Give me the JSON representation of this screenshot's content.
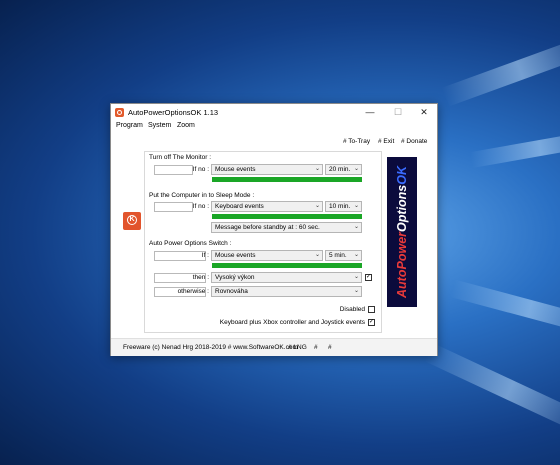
{
  "window": {
    "title": "AutoPowerOptionsOK 1.13",
    "controls": {
      "minimize": "—",
      "maximize": "☐",
      "close": "✕"
    }
  },
  "menu": [
    "Program",
    "System",
    "Zoom"
  ],
  "toolbar": {
    "to_tray": "# To-Tray",
    "exit": "# Exit",
    "donate": "# Donate"
  },
  "monitor": {
    "heading": "Turn off The Monitor :",
    "if_label": "If no :",
    "event": "Mouse events",
    "time": "20 min.",
    "progress": 1.0
  },
  "sleep": {
    "heading": "Put the Computer in to Sleep Mode :",
    "if_label": "If no :",
    "event": "Keyboard events",
    "time": "10 min.",
    "progress": 1.0,
    "message": "Message before standby at : 60 sec."
  },
  "switch": {
    "heading": "Auto Power Options Switch :",
    "if_label": "If :",
    "event": "Mouse events",
    "time": "5 min.",
    "progress": 1.0,
    "then_label": "then :",
    "then_value": "Vysoký výkon",
    "then_checked": true,
    "otherwise_label": "otherwise :",
    "otherwise_value": "Rovnováha"
  },
  "options": {
    "disabled_label": "Disabled",
    "disabled_checked": false,
    "keyboard_label": "Keyboard plus Xbox controller and Joystick events",
    "keyboard_checked": true
  },
  "banner": {
    "part1": "Auto",
    "part2": "Power",
    "part3": "Options",
    "part4": "OK"
  },
  "footer": {
    "freeware": "Freeware (c) Nenad Hrg 2018-2019 # www.SoftwareOK.com",
    "lng": "# LNG",
    "hash1": "#",
    "hash2": "#"
  },
  "colors": {
    "progress": "#1aa626",
    "logo": "#e2542c",
    "banner_bg": "#0b0b3c"
  }
}
